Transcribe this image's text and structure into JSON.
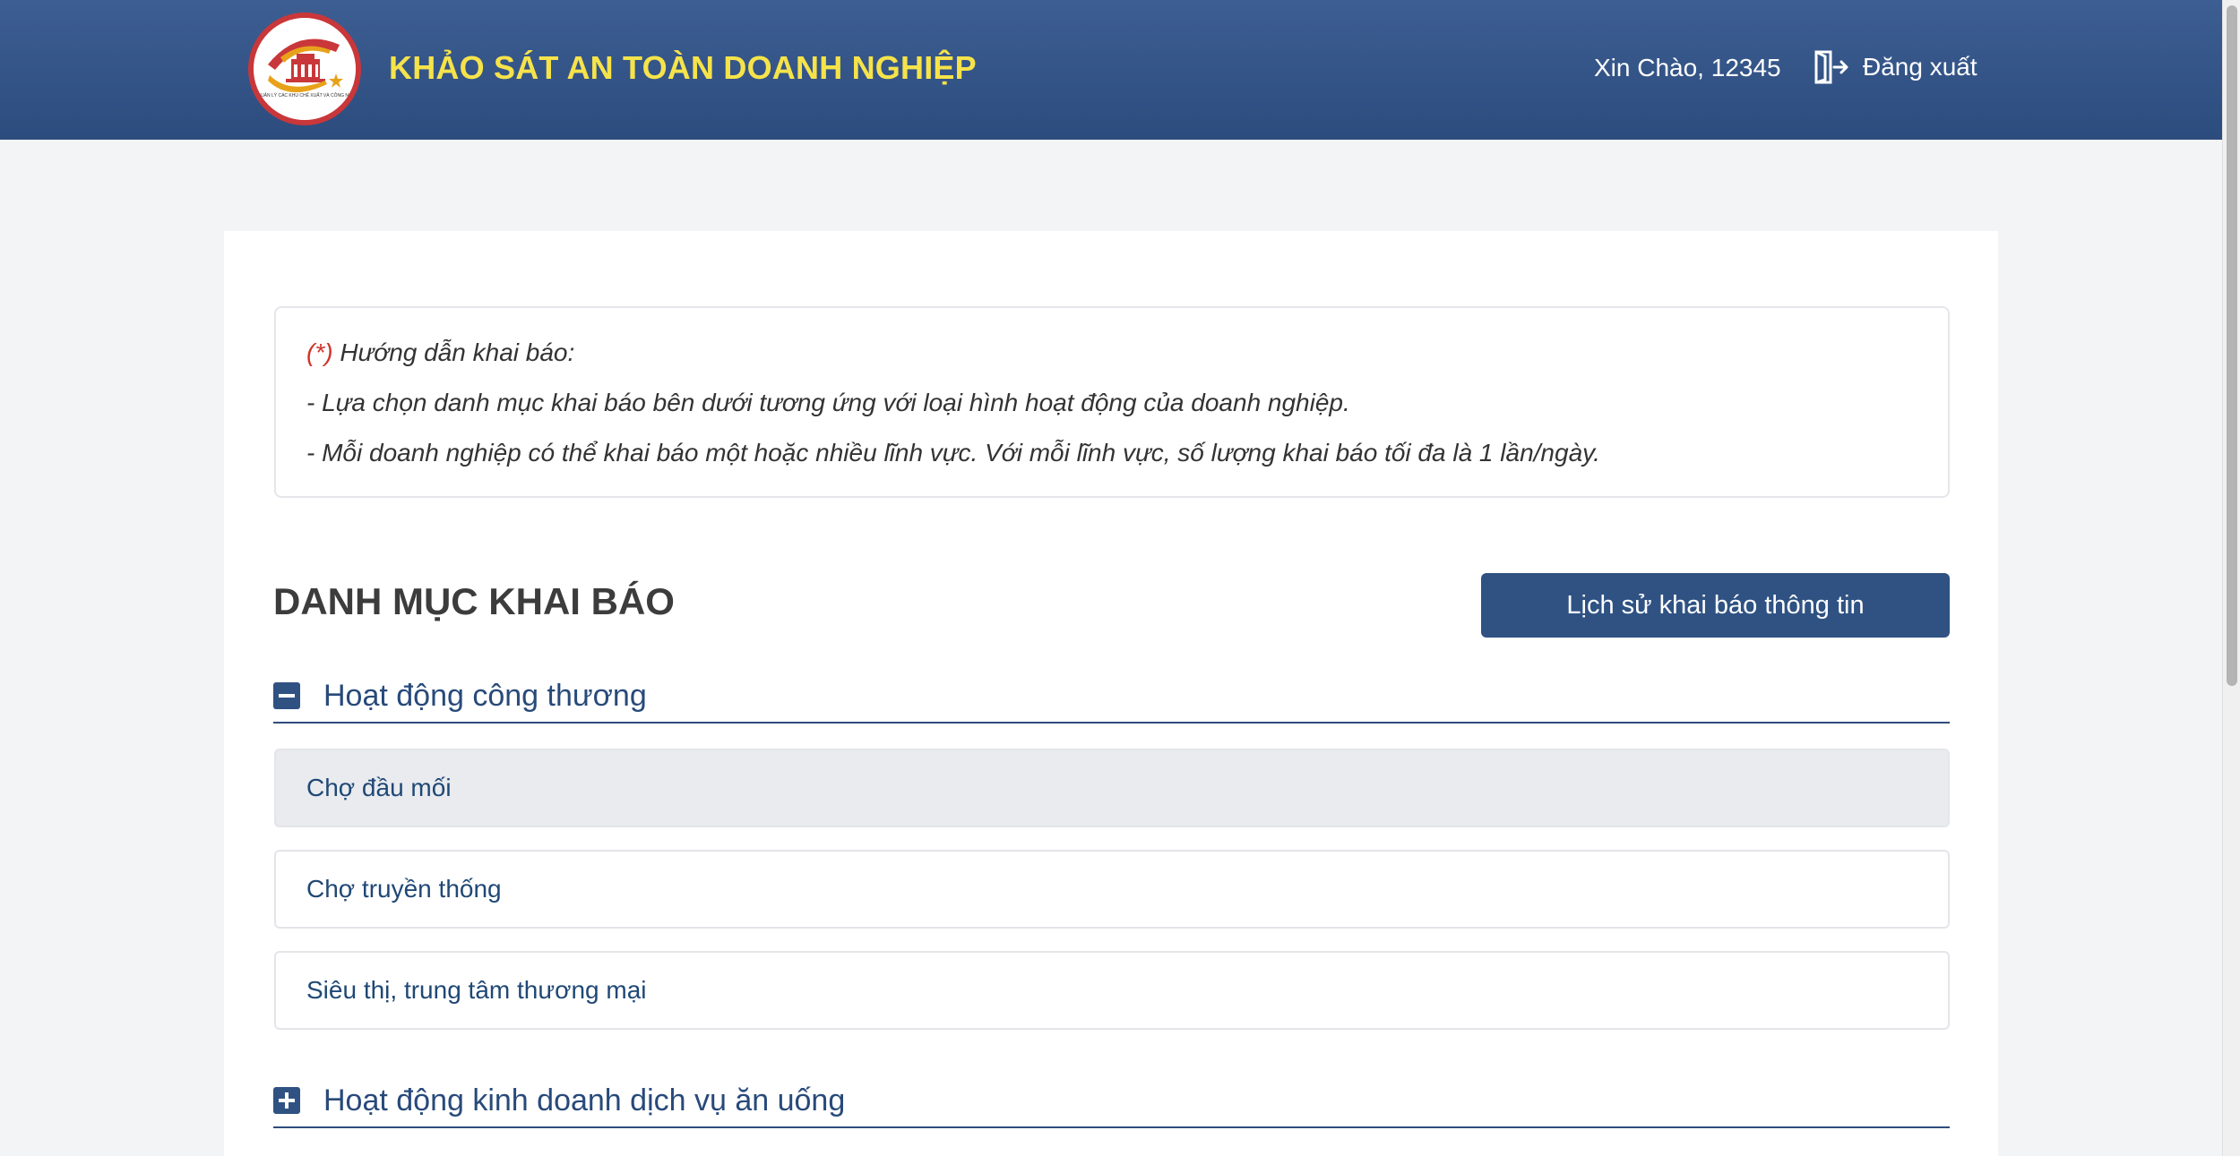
{
  "header": {
    "title": "KHẢO SÁT AN TOÀN DOANH NGHIỆP",
    "greeting": "Xin Chào, 12345",
    "logout_label": "Đăng xuất",
    "logo_text": "BAN QUẢN LÝ CÁC KHU CHẾ XUẤT VÀ CÔNG NGHIỆP"
  },
  "guide": {
    "required_mark": "(*)",
    "heading": " Hướng dẫn khai báo:",
    "line1": "- Lựa chọn danh mục khai báo bên dưới tương ứng với loại hình hoạt động của doanh nghiệp.",
    "line2": "- Mỗi doanh nghiệp có thể khai báo một hoặc nhiều lĩnh vực. Với mỗi lĩnh vực, số lượng khai báo tối đa là 1 lần/ngày."
  },
  "section": {
    "title": "DANH MỤC KHAI BÁO",
    "history_button": "Lịch sử khai báo thông tin"
  },
  "groups": [
    {
      "label": "Hoạt động công thương",
      "expanded": true,
      "items": [
        "Chợ đầu mối",
        "Chợ truyền thống",
        "Siêu thị, trung tâm thương mại"
      ]
    },
    {
      "label": "Hoạt động kinh doanh dịch vụ ăn uống",
      "expanded": false,
      "items": []
    }
  ],
  "colors": {
    "header_bg": "#35578a",
    "title_yellow": "#f6e34a",
    "primary_blue": "#2f5283",
    "required_red": "#d0342c"
  },
  "icons": {
    "logout": "logout-icon",
    "collapse": "minus-square-icon",
    "expand": "plus-square-icon"
  }
}
